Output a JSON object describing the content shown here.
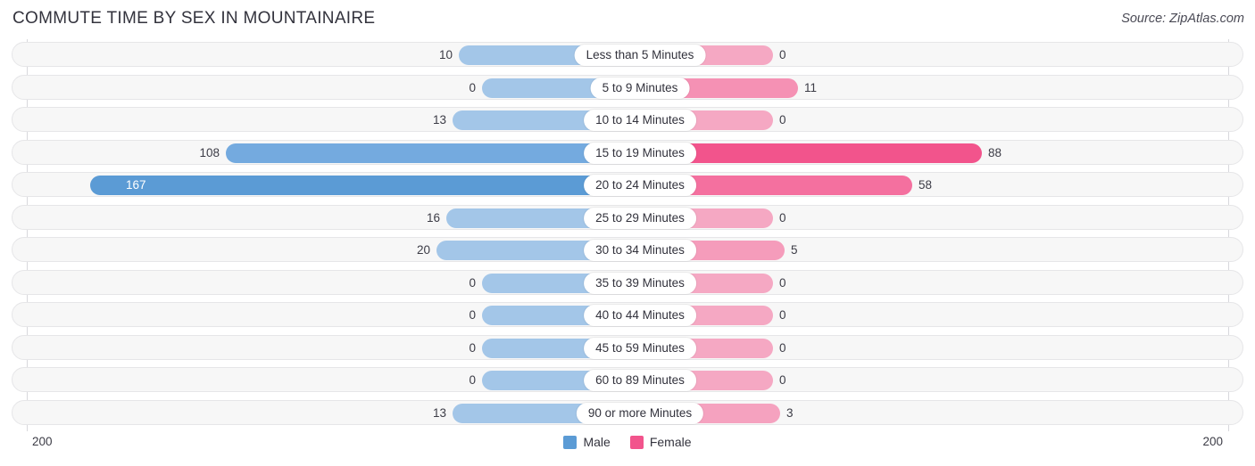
{
  "header": {
    "title": "COMMUTE TIME BY SEX IN MOUNTAINAIRE",
    "source": "Source: ZipAtlas.com"
  },
  "legend": {
    "male_label": "Male",
    "female_label": "Female",
    "male_color": "#5b9bd5",
    "female_color": "#f2548c"
  },
  "axis": {
    "left_label": "200",
    "right_label": "200",
    "max": 200
  },
  "chart_data": {
    "type": "bar",
    "orientation": "horizontal-diverging",
    "title": "COMMUTE TIME BY SEX IN MOUNTAINAIRE",
    "xlabel": "",
    "ylabel": "",
    "xlim": [
      200,
      200
    ],
    "grid": false,
    "legend_position": "bottom-center",
    "categories": [
      "Less than 5 Minutes",
      "5 to 9 Minutes",
      "10 to 14 Minutes",
      "15 to 19 Minutes",
      "20 to 24 Minutes",
      "25 to 29 Minutes",
      "30 to 34 Minutes",
      "35 to 39 Minutes",
      "40 to 44 Minutes",
      "45 to 59 Minutes",
      "60 to 89 Minutes",
      "90 or more Minutes"
    ],
    "series": [
      {
        "name": "Male",
        "values": [
          10,
          0,
          13,
          108,
          167,
          16,
          20,
          0,
          0,
          0,
          0,
          13
        ]
      },
      {
        "name": "Female",
        "values": [
          0,
          11,
          0,
          88,
          58,
          0,
          5,
          0,
          0,
          0,
          0,
          3
        ]
      }
    ]
  },
  "rows": [
    {
      "label": "Less than 5 Minutes",
      "male": "10",
      "female": "0",
      "male_w": 175,
      "female_w": 149,
      "male_c": "#a3c6e8",
      "female_c": "#f5a8c3",
      "male_inside": false,
      "female_inside": false
    },
    {
      "label": "5 to 9 Minutes",
      "male": "0",
      "female": "11",
      "male_w": 149,
      "female_w": 177,
      "male_c": "#a3c6e8",
      "female_c": "#f591b4",
      "male_inside": false,
      "female_inside": false
    },
    {
      "label": "10 to 14 Minutes",
      "male": "13",
      "female": "0",
      "male_w": 182,
      "female_w": 149,
      "male_c": "#a3c6e8",
      "female_c": "#f5a8c3",
      "male_inside": false,
      "female_inside": false
    },
    {
      "label": "15 to 19 Minutes",
      "male": "108",
      "female": "88",
      "male_w": 436,
      "female_w": 383,
      "male_c": "#74aadf",
      "female_c": "#f2548c",
      "male_inside": false,
      "female_inside": false
    },
    {
      "label": "20 to 24 Minutes",
      "male": "167",
      "female": "58",
      "male_w": 588,
      "female_w": 305,
      "male_c": "#5b9bd5",
      "female_c": "#f4709f",
      "male_inside": true,
      "female_inside": false
    },
    {
      "label": "25 to 29 Minutes",
      "male": "16",
      "female": "0",
      "male_w": 189,
      "female_w": 149,
      "male_c": "#a3c6e8",
      "female_c": "#f5a8c3",
      "male_inside": false,
      "female_inside": false
    },
    {
      "label": "30 to 34 Minutes",
      "male": "20",
      "female": "5",
      "male_w": 200,
      "female_w": 162,
      "male_c": "#a3c6e8",
      "female_c": "#f59cbb",
      "male_inside": false,
      "female_inside": false
    },
    {
      "label": "35 to 39 Minutes",
      "male": "0",
      "female": "0",
      "male_w": 149,
      "female_w": 149,
      "male_c": "#a3c6e8",
      "female_c": "#f5a8c3",
      "male_inside": false,
      "female_inside": false
    },
    {
      "label": "40 to 44 Minutes",
      "male": "0",
      "female": "0",
      "male_w": 149,
      "female_w": 149,
      "male_c": "#a3c6e8",
      "female_c": "#f5a8c3",
      "male_inside": false,
      "female_inside": false
    },
    {
      "label": "45 to 59 Minutes",
      "male": "0",
      "female": "0",
      "male_w": 149,
      "female_w": 149,
      "male_c": "#a3c6e8",
      "female_c": "#f5a8c3",
      "male_inside": false,
      "female_inside": false
    },
    {
      "label": "60 to 89 Minutes",
      "male": "0",
      "female": "0",
      "male_w": 149,
      "female_w": 149,
      "male_c": "#a3c6e8",
      "female_c": "#f5a8c3",
      "male_inside": false,
      "female_inside": false
    },
    {
      "label": "90 or more Minutes",
      "male": "13",
      "female": "3",
      "male_w": 182,
      "female_w": 157,
      "male_c": "#a3c6e8",
      "female_c": "#f5a2bf",
      "male_inside": false,
      "female_inside": false
    }
  ]
}
